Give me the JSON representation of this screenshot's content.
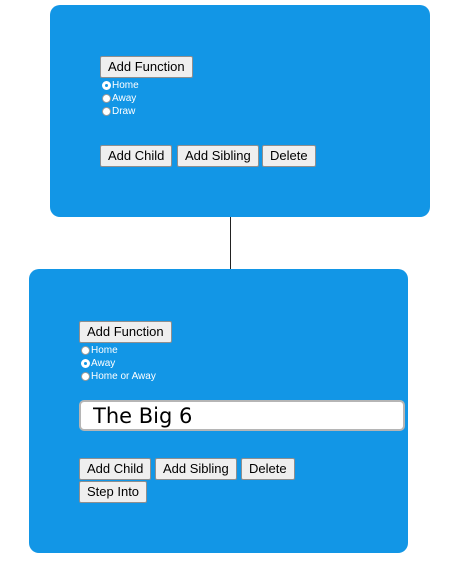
{
  "nodes": [
    {
      "add_function_label": "Add Function",
      "radio_options": [
        {
          "label": "Home",
          "checked": true
        },
        {
          "label": "Away",
          "checked": false
        },
        {
          "label": "Draw",
          "checked": false
        }
      ],
      "add_child_label": "Add Child",
      "add_sibling_label": "Add Sibling",
      "delete_label": "Delete"
    },
    {
      "add_function_label": "Add Function",
      "radio_options": [
        {
          "label": "Home",
          "checked": false
        },
        {
          "label": "Away",
          "checked": true
        },
        {
          "label": "Home or Away",
          "checked": false
        }
      ],
      "text_value": "The Big 6",
      "add_child_label": "Add Child",
      "add_sibling_label": "Add Sibling",
      "delete_label": "Delete",
      "step_into_label": "Step Into"
    }
  ],
  "colors": {
    "card_background": "#1296e6",
    "connector": "#222222"
  }
}
